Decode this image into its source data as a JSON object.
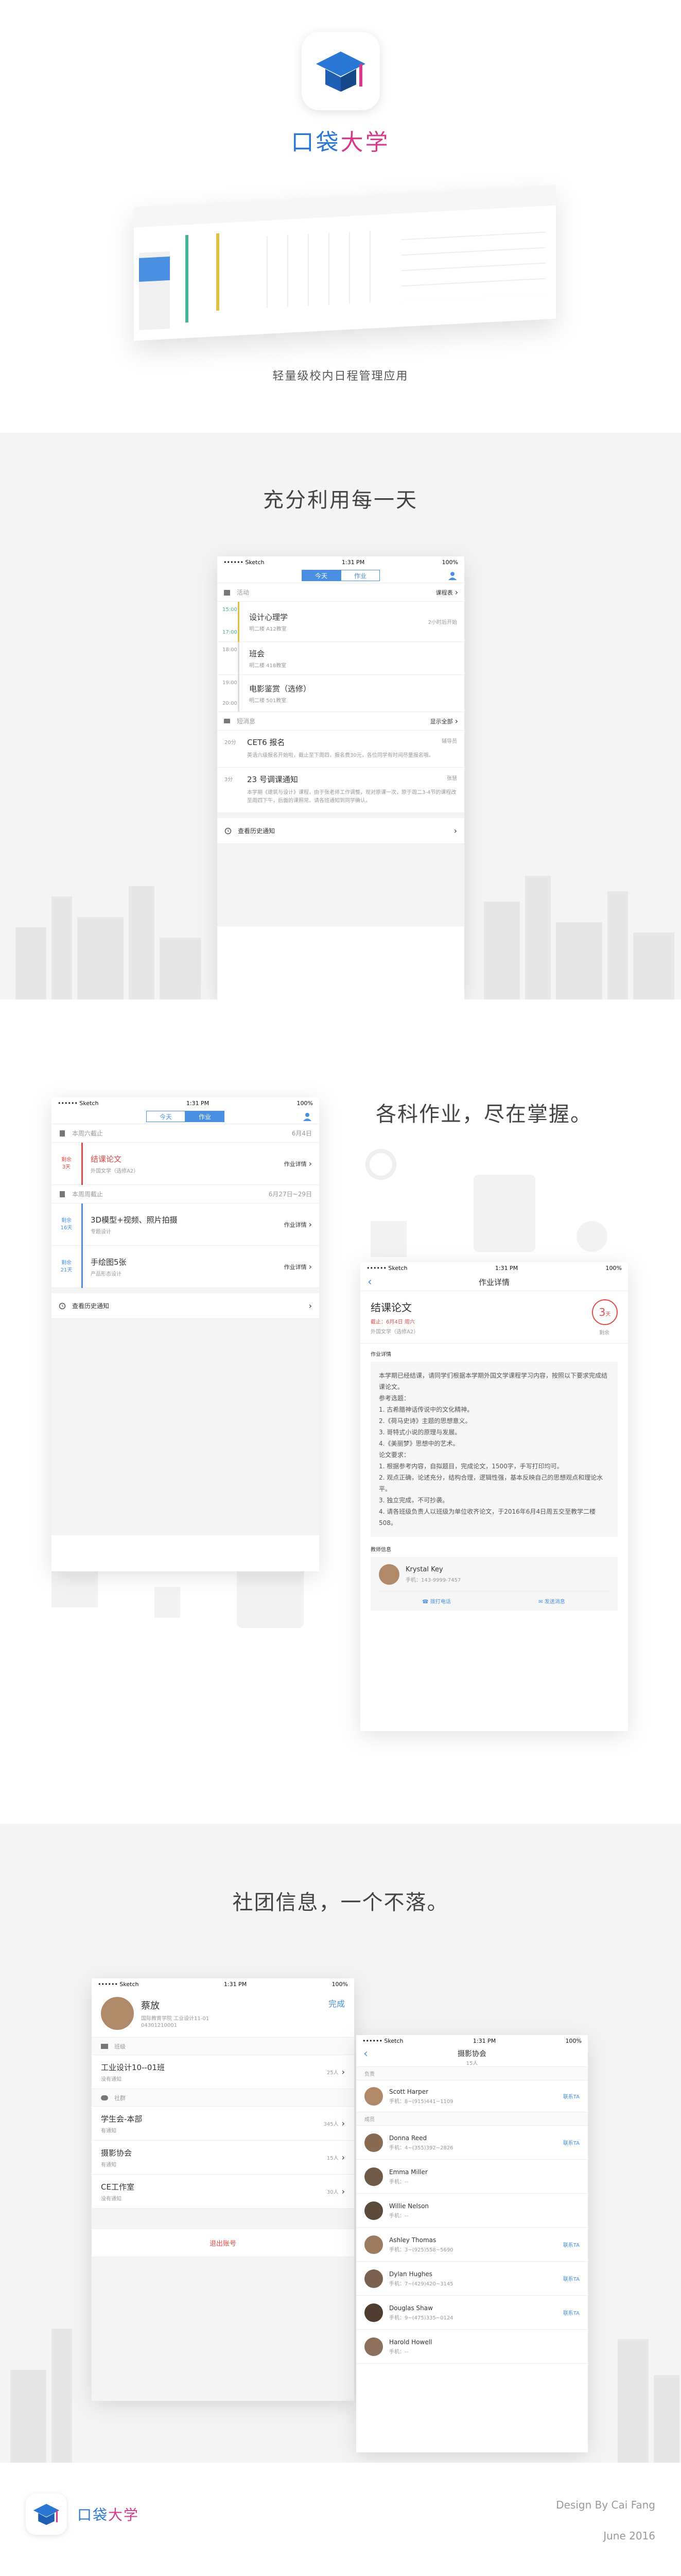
{
  "hero": {
    "title_part1": "口袋",
    "title_part2": "大学",
    "subtitle": "轻量级校内日程管理应用"
  },
  "section1": {
    "heading": "充分利用每一天",
    "status": {
      "carrier": "•••••• Sketch",
      "time": "1:31 PM",
      "battery": "100%"
    },
    "tabs": [
      "今天",
      "作业"
    ],
    "activity_header": "活动",
    "activity_action": "课程表",
    "courses": [
      {
        "time_start": "15:00",
        "time_end": "17:00",
        "title": "设计心理学",
        "place": "明二楼 A12教室",
        "note": "2小时后开始"
      },
      {
        "time_start": "18:00",
        "time_end": "",
        "title": "班会",
        "place": "明二楼 418教室",
        "note": ""
      },
      {
        "time_start": "19:00",
        "time_end": "20:00",
        "title": "电影鉴赏（选修）",
        "place": "明二楼 501教室",
        "note": ""
      }
    ],
    "notice_header": "短消息",
    "notice_action": "显示全部",
    "notices": [
      {
        "time": "20分",
        "title": "CET6 报名",
        "sender": "辅导员",
        "body": "英语六级报名开始啦，截止至下周四，报名费30元，各位同学有时间尽量报名哦。"
      },
      {
        "time": "3分",
        "title": "23 号调课通知",
        "sender": "张慧",
        "body": "本学期《建筑与设计》课程，由于张老师工作调整，现对原课一次，原于周二3-4节的课程改至周四下午，后面的课照常。请各班通知到同学确认。"
      }
    ],
    "history": "查看历史通知"
  },
  "section2": {
    "heading": "各科作业，尽在掌握。",
    "status": {
      "carrier": "•••••• Sketch",
      "time": "1:31 PM",
      "battery": "100%"
    },
    "tabs": [
      "今天",
      "作业"
    ],
    "groups": [
      {
        "header": "本周六截止",
        "date": "6月4日",
        "items": [
          {
            "badge_top": "剩余",
            "badge_days": "3天",
            "title": "结课论文",
            "course": "外国文学（选修A2）",
            "action": "作业详情",
            "urgent": true
          }
        ]
      },
      {
        "header": "本周周截止",
        "date": "6月27日~29日",
        "items": [
          {
            "badge_top": "剩余",
            "badge_days": "16天",
            "title": "3D模型+视频、照片拍摄",
            "course": "专题设计",
            "action": "作业详情",
            "urgent": false
          },
          {
            "badge_top": "剩余",
            "badge_days": "21天",
            "title": "手绘图5张",
            "course": "产品形态设计",
            "action": "作业详情",
            "urgent": false
          }
        ]
      }
    ],
    "history": "查看历史通知",
    "detail": {
      "nav_title": "作业详情",
      "title": "结课论文",
      "deadline": "截止：6月4日 周六",
      "course": "外国文学（选修A2）",
      "days_num": "3",
      "days_unit": "天",
      "days_label": "剩余",
      "section_label": "作业详情",
      "body": [
        "本学期已经结课，请同学们根据本学期外国文学课程学习内容，按照以下要求完成结课论文。",
        "参考选题：",
        "1. 古希腊神话传说中的文化精神。",
        "2.《荷马史诗》主题的思想意义。",
        "3. 哥特式小说的原理与发展。",
        "4.《美丽梦》思想中的艺术。",
        "论文要求：",
        "1. 根据参考内容，自拟题目，完成论文，1500字，手写打印均可。",
        "2. 观点正确，论述充分，结构合理，逻辑性强，基本反映自己的思想观点和理论水平。",
        "3. 独立完成，不可抄袭。",
        "4. 请各班级负责人以班级为单位收齐论文，于2016年6月4日周五交至教学二楼508。"
      ],
      "teacher_label": "教师信息",
      "teacher_name": "Krystal Key",
      "teacher_phone": "手机：143-9999-7457",
      "call": "拨打电话",
      "message": "发送消息"
    }
  },
  "section3": {
    "heading": "社团信息，一个不落。",
    "status": {
      "carrier": "•••••• Sketch",
      "time": "1:31 PM",
      "battery": "100%"
    },
    "profile": {
      "name": "蔡放",
      "dept": "国际教育学院 工业设计11-01",
      "id": "04301210001",
      "done": "完成"
    },
    "class_label": "班级",
    "classes": [
      {
        "name": "工业设计10--01班",
        "sub": "没有通知",
        "count": "25人"
      }
    ],
    "club_label": "社群",
    "clubs": [
      {
        "name": "学生会-本部",
        "sub": "有通知",
        "count": "345人"
      },
      {
        "name": "摄影协会",
        "sub": "有通知",
        "count": "15人"
      },
      {
        "name": "CE工作室",
        "sub": "没有通知",
        "count": "30人"
      }
    ],
    "logout": "退出账号",
    "club_page": {
      "title": "摄影协会",
      "subtitle": "15人",
      "leader_label": "负责",
      "member_label": "成员",
      "contact": "联系TA",
      "leader": [
        {
          "name": "Scott Harper",
          "phone": "手机：8~(915)441~1109"
        }
      ],
      "members": [
        {
          "name": "Donna Reed",
          "phone": "手机：4~(355)392~2826"
        },
        {
          "name": "Emma Miller",
          "phone": "手机：--"
        },
        {
          "name": "Willie Nelson",
          "phone": "手机：--"
        },
        {
          "name": "Ashley Thomas",
          "phone": "手机：3~(925)558~5690"
        },
        {
          "name": "Dylan Hughes",
          "phone": "手机：7~(429)420~3145"
        },
        {
          "name": "Douglas Shaw",
          "phone": "手机：9~(475)335~0124"
        },
        {
          "name": "Harold Howell",
          "phone": "手机：--"
        }
      ]
    }
  },
  "footer": {
    "logo_part1": "口袋",
    "logo_part2": "大学",
    "credit": "Design By Cai Fang",
    "date": "June 2016"
  },
  "colors": {
    "accent": "#4a90e2",
    "logo_pink": "#d63a8c",
    "urgent": "#e24a4a"
  }
}
